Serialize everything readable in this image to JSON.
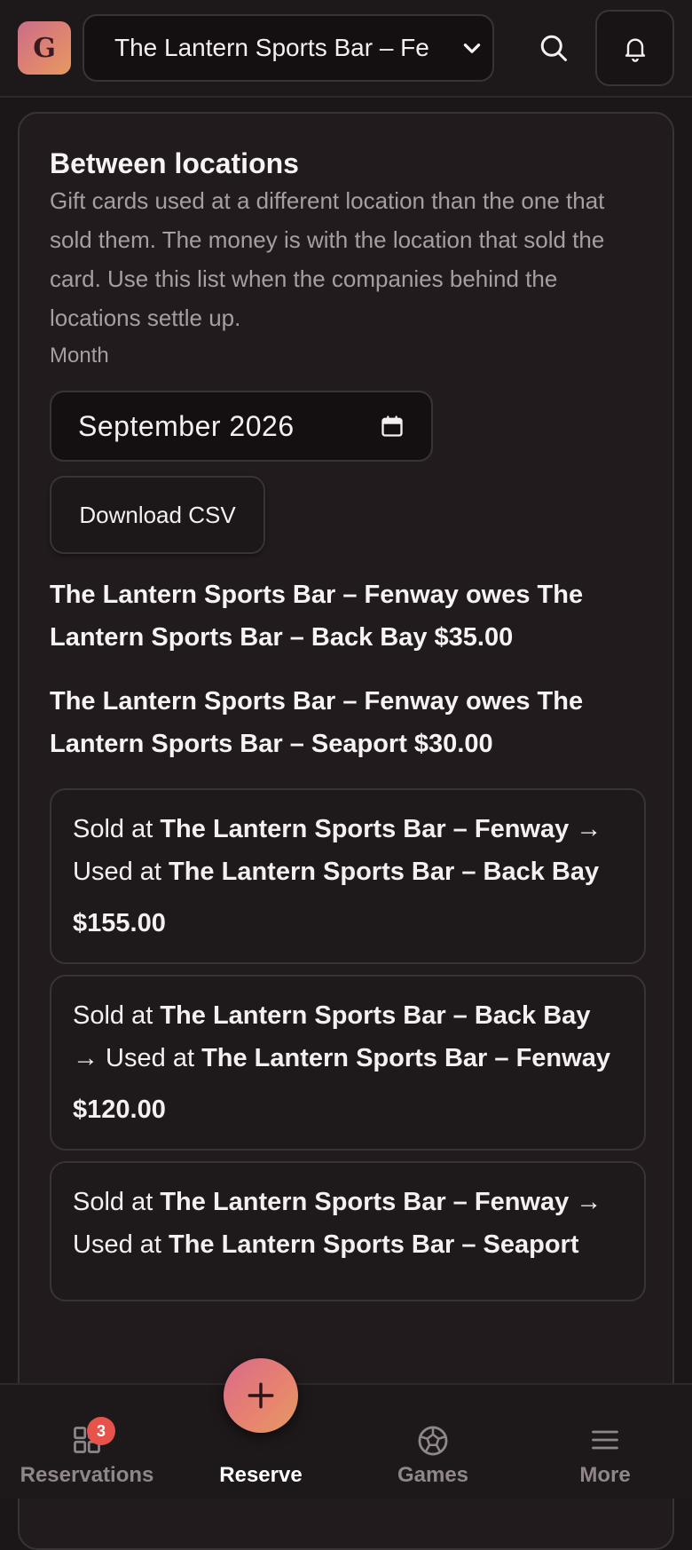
{
  "header": {
    "logo_letter": "G",
    "location_value": "The Lantern Sports Bar – Fe"
  },
  "section": {
    "title": "Between locations",
    "description": "Gift cards used at a different location than the one that sold them. The money is with the location that sold the card. Use this list when the companies behind the locations settle up.",
    "month_label": "Month",
    "month_value": "September 2026",
    "download_label": "Download CSV"
  },
  "settlements": [
    "The Lantern Sports Bar – Fenway owes The Lantern Sports Bar – Back Bay $35.00",
    "The Lantern Sports Bar – Fenway owes The Lantern Sports Bar – Seaport $30.00"
  ],
  "transfers": [
    {
      "sold_prefix": "Sold at ",
      "sold_at": "The Lantern Sports Bar – Fenway",
      "used_prefix": "→ Used at ",
      "used_at": "The Lantern Sports Bar – Back Bay",
      "amount": "$155.00"
    },
    {
      "sold_prefix": "Sold at ",
      "sold_at": "The Lantern Sports Bar – Back Bay",
      "used_prefix": "→ Used at ",
      "used_at": "The Lantern Sports Bar – Fenway",
      "amount": "$120.00"
    },
    {
      "sold_prefix": "Sold at ",
      "sold_at": "The Lantern Sports Bar – Fenway",
      "used_prefix": "→ Used at ",
      "used_at": "The Lantern Sports Bar – Seaport",
      "amount": ""
    }
  ],
  "nav": {
    "reservations_label": "Reservations",
    "reservations_badge": "3",
    "reserve_label": "Reserve",
    "games_label": "Games",
    "more_label": "More"
  },
  "colors": {
    "background": "#1b1618",
    "accent_gradient_start": "#d96a8a",
    "accent_gradient_end": "#e29a62",
    "badge": "#e5534b"
  },
  "icons": [
    "search-icon",
    "bell-icon",
    "chevron-down-icon",
    "calendar-icon",
    "grid-icon",
    "plus-icon",
    "soccer-ball-icon",
    "menu-icon"
  ]
}
